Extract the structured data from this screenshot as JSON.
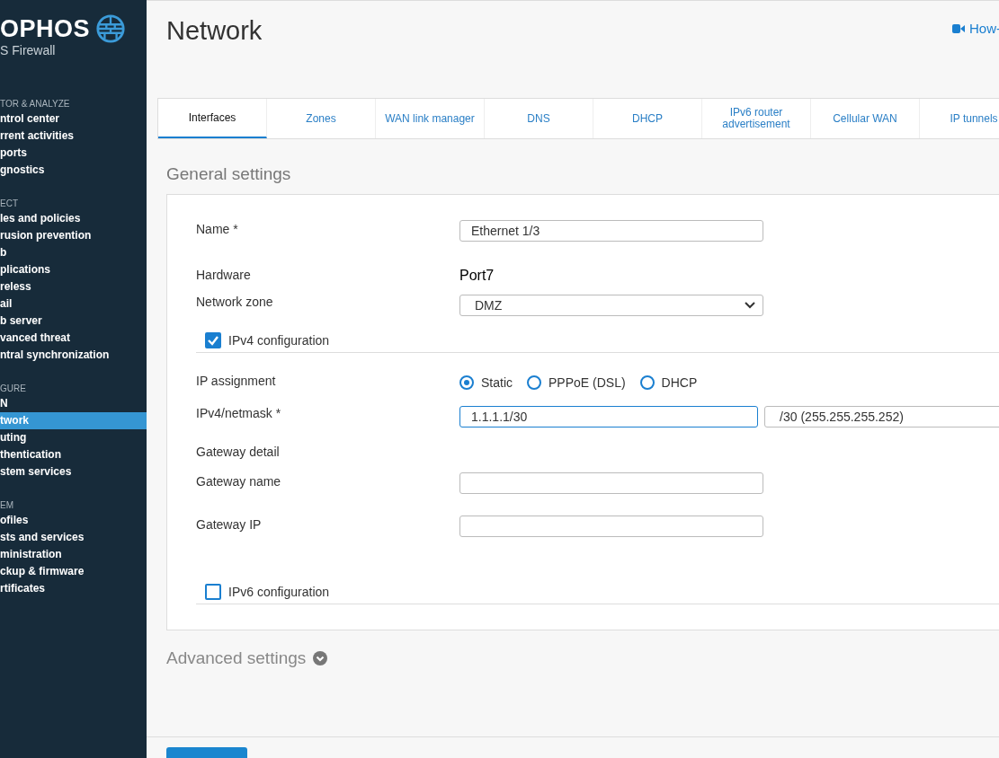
{
  "sidebar": {
    "logo": {
      "brand": "OPHOS",
      "product": "S Firewall"
    },
    "sections": [
      {
        "heading": "TOR & ANALYZE",
        "items": [
          {
            "label": "ntrol center",
            "selected": false
          },
          {
            "label": "rrent activities",
            "selected": false
          },
          {
            "label": "ports",
            "selected": false
          },
          {
            "label": "gnostics",
            "selected": false
          }
        ]
      },
      {
        "heading": "ECT",
        "items": [
          {
            "label": "les and policies",
            "selected": false
          },
          {
            "label": "rusion prevention",
            "selected": false
          },
          {
            "label": "b",
            "selected": false
          },
          {
            "label": "plications",
            "selected": false
          },
          {
            "label": "reless",
            "selected": false
          },
          {
            "label": "ail",
            "selected": false
          },
          {
            "label": "b server",
            "selected": false
          },
          {
            "label": "vanced threat",
            "selected": false
          },
          {
            "label": "ntral synchronization",
            "selected": false
          }
        ]
      },
      {
        "heading": "GURE",
        "items": [
          {
            "label": "N",
            "selected": false
          },
          {
            "label": "twork",
            "selected": true
          },
          {
            "label": "uting",
            "selected": false
          },
          {
            "label": "thentication",
            "selected": false
          },
          {
            "label": "stem services",
            "selected": false
          }
        ]
      },
      {
        "heading": "EM",
        "items": [
          {
            "label": "ofiles",
            "selected": false
          },
          {
            "label": "sts and services",
            "selected": false
          },
          {
            "label": "ministration",
            "selected": false
          },
          {
            "label": "ckup & firmware",
            "selected": false
          },
          {
            "label": "rtificates",
            "selected": false
          }
        ]
      }
    ]
  },
  "header": {
    "title": "Network",
    "help_link": "How-"
  },
  "tabs": [
    {
      "label": "Interfaces",
      "selected": true
    },
    {
      "label": "Zones",
      "selected": false
    },
    {
      "label": "WAN link manager",
      "selected": false
    },
    {
      "label": "DNS",
      "selected": false
    },
    {
      "label": "DHCP",
      "selected": false
    },
    {
      "label": "IPv6 router advertisement",
      "selected": false
    },
    {
      "label": "Cellular WAN",
      "selected": false
    },
    {
      "label": "IP tunnels",
      "selected": false
    }
  ],
  "general_settings": {
    "heading": "General settings",
    "fields": [
      {
        "kind": "text",
        "label": "Name *",
        "value": "Ethernet 1/3"
      },
      {
        "kind": "static",
        "label": "Hardware",
        "value": "Port7"
      },
      {
        "kind": "select",
        "label": "Network zone",
        "value": "DMZ"
      },
      {
        "kind": "checkbox",
        "label": "IPv4 configuration",
        "checked": true
      },
      {
        "kind": "radio",
        "label": "IP assignment",
        "options": [
          {
            "label": "Static",
            "selected": true
          },
          {
            "label": "PPPoE (DSL)",
            "selected": false
          },
          {
            "label": "DHCP",
            "selected": false
          }
        ]
      },
      {
        "kind": "address",
        "label": "IPv4/netmask *",
        "value": "1.1.1.1/30",
        "netmask": "/30 (255.255.255.252)"
      },
      {
        "kind": "heading",
        "label": "Gateway detail"
      },
      {
        "kind": "text",
        "label": "Gateway name"
      },
      {
        "kind": "text",
        "label": "Gateway IP"
      },
      {
        "kind": "checkbox",
        "label": "IPv6 configuration",
        "checked": false
      }
    ]
  },
  "advanced_settings": {
    "heading": "Advanced settings",
    "expanded": false
  },
  "footer_buttons": [
    {
      "kind": "primary"
    }
  ]
}
